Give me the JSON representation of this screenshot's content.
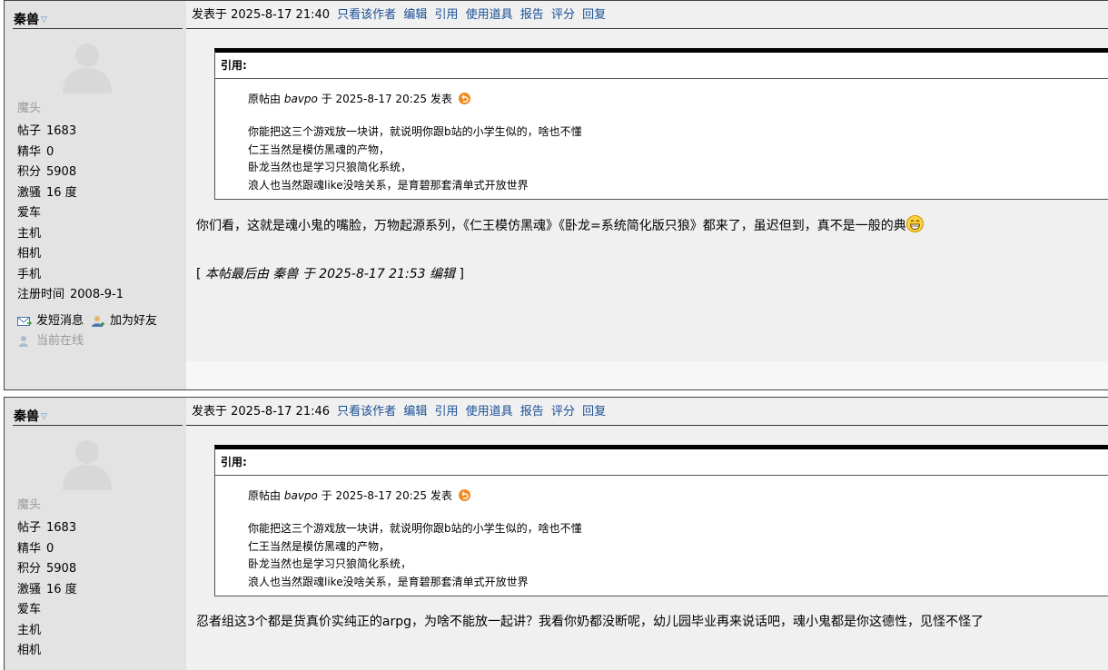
{
  "posts": [
    {
      "user": {
        "name": "秦兽",
        "rank": "魔头"
      },
      "stats": [
        {
          "label": "帖子",
          "value": "1683"
        },
        {
          "label": "精华",
          "value": "0"
        },
        {
          "label": "积分",
          "value": "5908"
        },
        {
          "label": "激骚",
          "value": "16 度"
        },
        {
          "label": "爱车",
          "value": ""
        },
        {
          "label": "主机",
          "value": ""
        },
        {
          "label": "相机",
          "value": ""
        },
        {
          "label": "手机",
          "value": ""
        },
        {
          "label": "注册时间",
          "value": "2008-9-1"
        }
      ],
      "actions": {
        "pm": "发短消息",
        "friend": "加为好友",
        "online": "当前在线"
      },
      "posted": "发表于 2025-8-17 21:40",
      "links": [
        "只看该作者",
        "编辑",
        "引用",
        "使用道具",
        "报告",
        "评分",
        "回复"
      ],
      "quote": {
        "head": "引用:",
        "meta_prefix": "原帖由",
        "author": "bavpo",
        "meta_suffix": "于 2025-8-17 20:25 发表",
        "lines": [
          "你能把这三个游戏放一块讲，就说明你跟b站的小学生似的，啥也不懂",
          "仁王当然是模仿黑魂的产物，",
          "卧龙当然也是学习只狼简化系统，",
          "浪人也当然跟魂like没啥关系，是育碧那套清单式开放世界"
        ]
      },
      "reply": "你们看，这就是魂小鬼的嘴脸，万物起源系列，《仁王模仿黑魂》《卧龙=系统简化版只狼》都来了，虽迟但到，真不是一般的典",
      "edited": {
        "open": "[",
        "text": "本帖最后由 秦兽 于 2025-8-17 21:53 编辑",
        "close": "]"
      }
    },
    {
      "user": {
        "name": "秦兽",
        "rank": "魔头"
      },
      "stats": [
        {
          "label": "帖子",
          "value": "1683"
        },
        {
          "label": "精华",
          "value": "0"
        },
        {
          "label": "积分",
          "value": "5908"
        },
        {
          "label": "激骚",
          "value": "16 度"
        },
        {
          "label": "爱车",
          "value": ""
        },
        {
          "label": "主机",
          "value": ""
        },
        {
          "label": "相机",
          "value": ""
        }
      ],
      "posted": "发表于 2025-8-17 21:46",
      "links": [
        "只看该作者",
        "编辑",
        "引用",
        "使用道具",
        "报告",
        "评分",
        "回复"
      ],
      "quote": {
        "head": "引用:",
        "meta_prefix": "原帖由",
        "author": "bavpo",
        "meta_suffix": "于 2025-8-17 20:25 发表",
        "lines": [
          "你能把这三个游戏放一块讲，就说明你跟b站的小学生似的，啥也不懂",
          "仁王当然是模仿黑魂的产物，",
          "卧龙当然也是学习只狼简化系统，",
          "浪人也当然跟魂like没啥关系，是育碧那套清单式开放世界"
        ]
      },
      "reply": "忍者组这3个都是货真价实纯正的arpg，为啥不能放一起讲？我看你奶都没断呢，幼儿园毕业再来说话吧，魂小鬼都是你这德性，见怪不怪了"
    }
  ],
  "colors": {
    "link": "#1a4f96",
    "sidebar": "#e3e3e3",
    "content": "#f0f0f0",
    "muted": "#999999",
    "return_icon": "#f08a1c"
  }
}
